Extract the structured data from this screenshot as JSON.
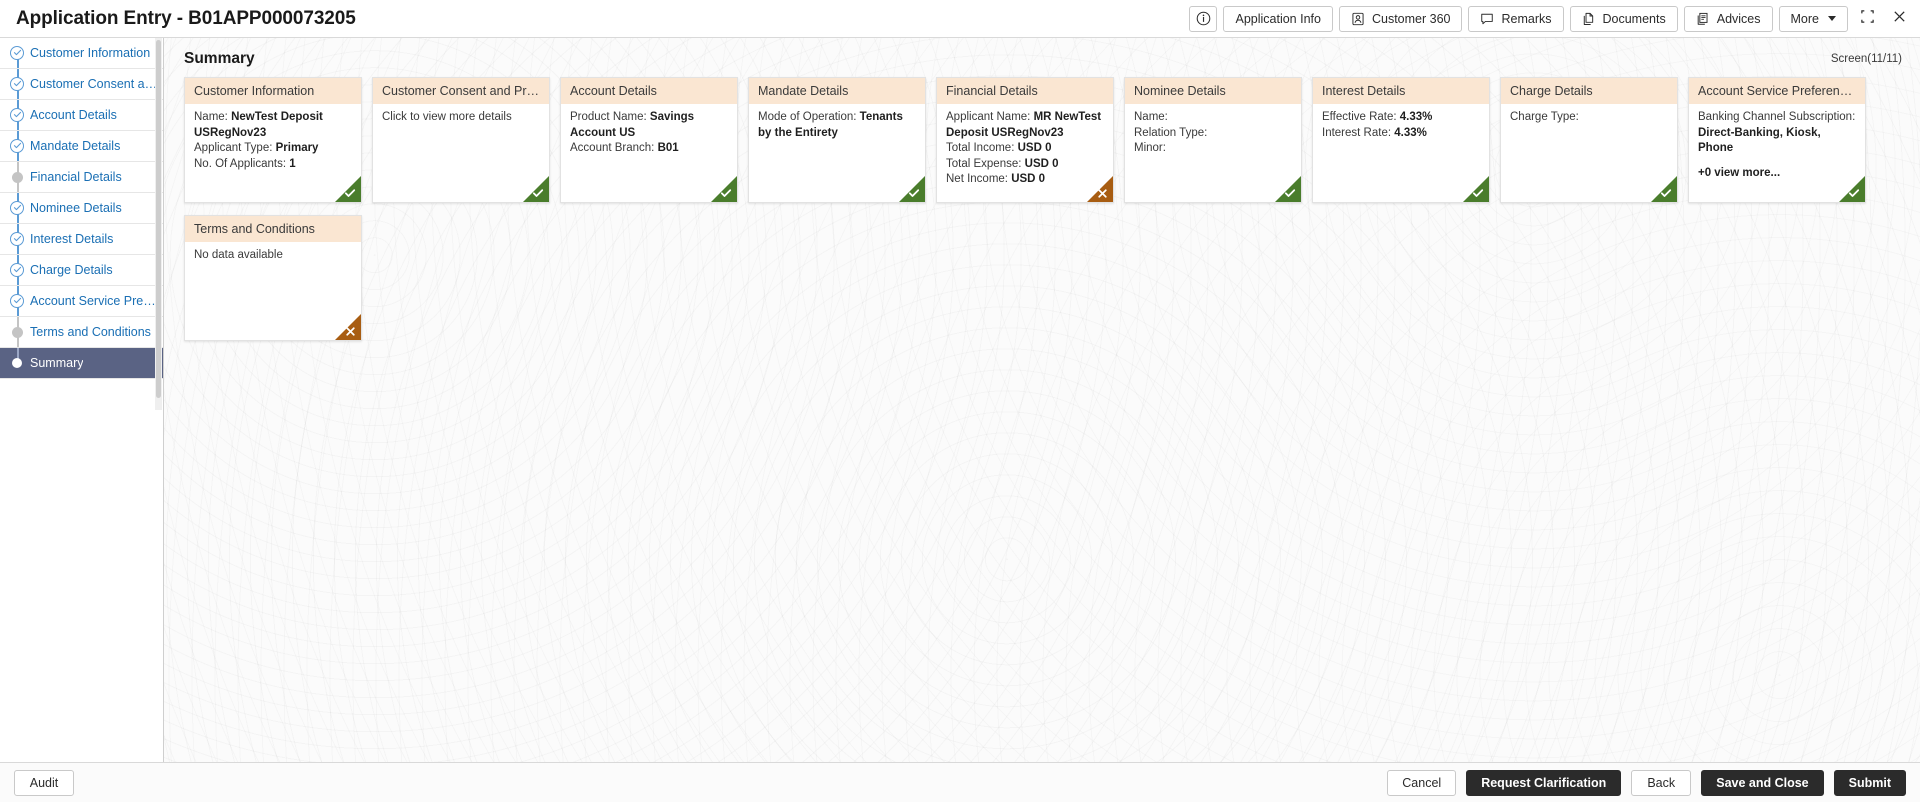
{
  "header": {
    "title": "Application Entry - B01APP000073205",
    "actions": [
      {
        "name": "info-button",
        "label": "",
        "icon": "info-circle-icon"
      },
      {
        "name": "application-info-button",
        "label": "Application Info",
        "icon": ""
      },
      {
        "name": "customer-360-button",
        "label": "Customer 360",
        "icon": "person-badge-icon"
      },
      {
        "name": "remarks-button",
        "label": "Remarks",
        "icon": "speech-bubble-icon"
      },
      {
        "name": "documents-button",
        "label": "Documents",
        "icon": "documents-icon"
      },
      {
        "name": "advices-button",
        "label": "Advices",
        "icon": "advices-icon"
      },
      {
        "name": "more-button",
        "label": "More",
        "icon": "chevron-down-icon"
      }
    ],
    "window": {
      "collapse": "collapse-icon",
      "close": "close-icon"
    }
  },
  "sidebar": {
    "items": [
      {
        "label": "Customer Information",
        "state": "done"
      },
      {
        "label": "Customer Consent and ...",
        "state": "done"
      },
      {
        "label": "Account Details",
        "state": "done"
      },
      {
        "label": "Mandate Details",
        "state": "done"
      },
      {
        "label": "Financial Details",
        "state": "pending"
      },
      {
        "label": "Nominee Details",
        "state": "done"
      },
      {
        "label": "Interest Details",
        "state": "done"
      },
      {
        "label": "Charge Details",
        "state": "done"
      },
      {
        "label": "Account Service Prefere ...",
        "state": "done"
      },
      {
        "label": "Terms and Conditions",
        "state": "pending"
      },
      {
        "label": "Summary",
        "state": "active"
      }
    ]
  },
  "main": {
    "title": "Summary",
    "screen_count": "Screen(11/11)",
    "cards": [
      {
        "title": "Customer Information",
        "status": "ok",
        "lines": [
          {
            "label": "Name: ",
            "value": "NewTest Deposit USRegNov23"
          },
          {
            "label": "Applicant Type: ",
            "value": "Primary"
          },
          {
            "label": "No. Of Applicants: ",
            "value": "1"
          }
        ]
      },
      {
        "title": "Customer Consent and Pref...",
        "status": "ok",
        "lines": [
          {
            "label": "Click to view more details",
            "value": ""
          }
        ]
      },
      {
        "title": "Account Details",
        "status": "ok",
        "lines": [
          {
            "label": "Product Name: ",
            "value": "Savings Account US"
          },
          {
            "label": "Account Branch: ",
            "value": "B01"
          }
        ]
      },
      {
        "title": "Mandate Details",
        "status": "ok",
        "lines": [
          {
            "label": "Mode of Operation: ",
            "value": "Tenants by the Entirety"
          }
        ]
      },
      {
        "title": "Financial Details",
        "status": "err",
        "lines": [
          {
            "label": "Applicant Name: ",
            "value": "MR NewTest Deposit USRegNov23"
          },
          {
            "label": "Total Income: ",
            "value": "USD 0"
          },
          {
            "label": "Total Expense: ",
            "value": "USD 0"
          },
          {
            "label": "Net Income: ",
            "value": "USD 0"
          }
        ]
      },
      {
        "title": "Nominee Details",
        "status": "ok",
        "lines": [
          {
            "label": "Name:",
            "value": ""
          },
          {
            "label": "Relation Type:",
            "value": ""
          },
          {
            "label": "Minor:",
            "value": ""
          }
        ]
      },
      {
        "title": "Interest Details",
        "status": "ok",
        "lines": [
          {
            "label": "Effective Rate: ",
            "value": "4.33%"
          },
          {
            "label": "Interest Rate: ",
            "value": "4.33%"
          }
        ]
      },
      {
        "title": "Charge Details",
        "status": "ok",
        "lines": [
          {
            "label": "Charge Type:",
            "value": ""
          }
        ]
      },
      {
        "title": "Account Service Preferences",
        "status": "ok",
        "lines": [
          {
            "label": "Banking Channel Subscription: ",
            "value": "Direct-Banking, Kiosk, Phone"
          }
        ],
        "more": "+0 view more..."
      },
      {
        "title": "Terms and Conditions",
        "status": "err",
        "lines": [
          {
            "label": "No data available",
            "value": ""
          }
        ]
      }
    ]
  },
  "footer": {
    "audit": "Audit",
    "cancel": "Cancel",
    "request_clarification": "Request Clarification",
    "back": "Back",
    "save_and_close": "Save and Close",
    "submit": "Submit"
  },
  "colors": {
    "card_header": "#fae6d2",
    "status_ok": "#4a7d2c",
    "status_error": "#a85d12",
    "active_nav": "#5a6384",
    "link": "#1a6fb4"
  }
}
